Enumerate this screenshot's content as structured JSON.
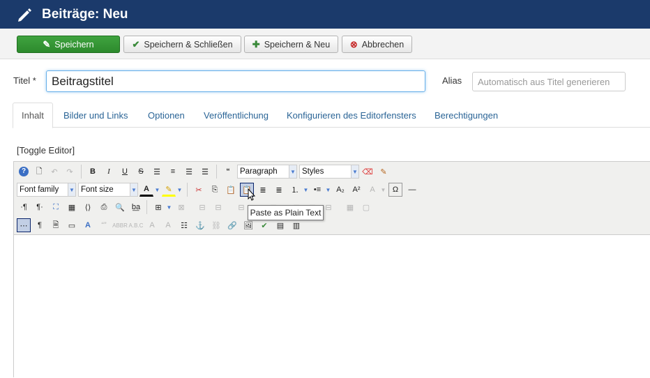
{
  "header": {
    "title": "Beiträge: Neu",
    "icon": "pencil-icon"
  },
  "actions": {
    "save": "Speichern",
    "save_close": "Speichern & Schließen",
    "save_new": "Speichern & Neu",
    "cancel": "Abbrechen"
  },
  "form": {
    "title_label": "Titel *",
    "title_value": "Beitragstitel",
    "alias_label": "Alias",
    "alias_placeholder": "Automatisch aus Titel generieren"
  },
  "tabs": [
    "Inhalt",
    "Bilder und Links",
    "Optionen",
    "Veröffentlichung",
    "Konfigurieren des Editorfensters",
    "Berechtigungen"
  ],
  "editor": {
    "toggle": "[Toggle Editor]",
    "format_select": "Paragraph",
    "styles_select": "Styles",
    "font_family_select": "Font family",
    "font_size_select": "Font size",
    "tooltip": "Paste as Plain Text"
  },
  "colors": {
    "header_bg": "#1b3a6b",
    "primary": "#2d8a2d",
    "link": "#2a6496"
  }
}
